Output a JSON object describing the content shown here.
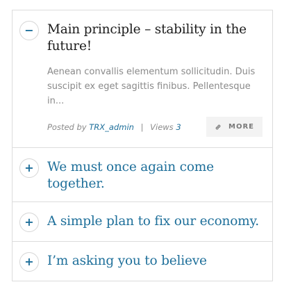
{
  "accordion": {
    "items": [
      {
        "toggle": "−",
        "title": "Main principle – stability in the future!",
        "excerpt": "Aenean convallis elementum sollicitudin. Duis suscipit ex eget sagittis finibus. Pellentesque in...",
        "posted_by_label": "Posted by",
        "author": "TRX_admin",
        "separator": "|",
        "views_label": "Views",
        "views_count": "3",
        "more_label": "MORE"
      },
      {
        "toggle": "+",
        "title": "We must once again come together."
      },
      {
        "toggle": "+",
        "title": "A simple plan to fix our economy."
      },
      {
        "toggle": "+",
        "title": "I’m asking you to believe"
      }
    ]
  },
  "colors": {
    "accent": "#1e6f9a",
    "text_dark": "#1c1c1c",
    "text_muted": "#8a8a8a",
    "border": "#dcdcdc",
    "button_bg": "#f3f3f3"
  }
}
